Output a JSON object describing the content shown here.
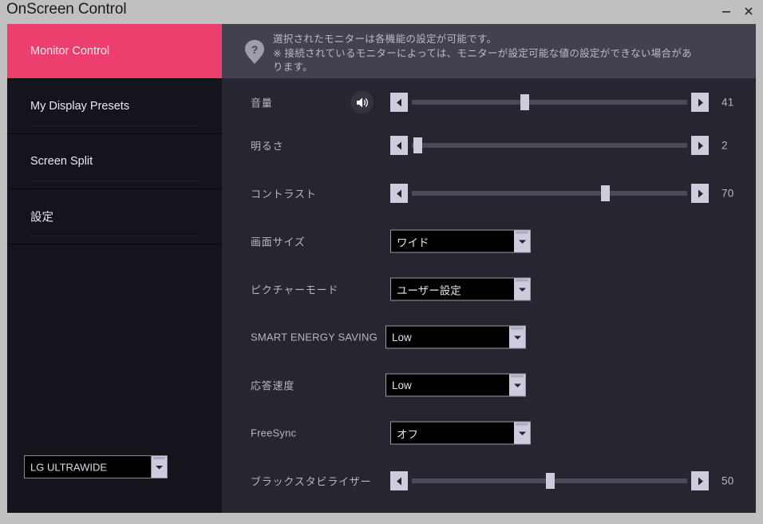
{
  "window": {
    "title": "OnScreen Control",
    "minimize_label": "minimize",
    "close_label": "close"
  },
  "sidebar": {
    "items": [
      {
        "label": "Monitor Control",
        "active": true
      },
      {
        "label": "My Display Presets",
        "active": false
      },
      {
        "label": "Screen Split",
        "active": false
      },
      {
        "label": "設定",
        "active": false
      }
    ],
    "monitor_select": {
      "value": "LG ULTRAWIDE",
      "icon": "chevron-down-icon"
    }
  },
  "help": {
    "icon": "question-mark-icon",
    "line1": "選択されたモニターは各機能の設定が可能です。",
    "line2": "※ 接続されているモニターによっては、モニターが設定可能な値の設定ができない場合があ",
    "line3": "ります。"
  },
  "controls": {
    "rows": [
      {
        "label": "音量",
        "type": "slider",
        "value": "41",
        "percent": 41,
        "has_speaker_icon": true,
        "speaker_icon": "speaker-volume-icon",
        "left_icon": "triangle-left-icon",
        "right_icon": "triangle-right-icon"
      },
      {
        "label": "明るさ",
        "type": "slider",
        "value": "2",
        "percent": 2,
        "has_speaker_icon": false,
        "left_icon": "triangle-left-icon",
        "right_icon": "triangle-right-icon"
      },
      {
        "label": "コントラスト",
        "type": "slider",
        "value": "70",
        "percent": 70,
        "has_speaker_icon": false,
        "left_icon": "triangle-left-icon",
        "right_icon": "triangle-right-icon"
      },
      {
        "label": "画面サイズ",
        "type": "dropdown",
        "value": "ワイド",
        "icon": "chevron-down-icon"
      },
      {
        "label": "ピクチャーモード",
        "type": "dropdown",
        "value": "ユーザー設定",
        "icon": "chevron-down-icon"
      },
      {
        "label": "SMART ENERGY SAVING",
        "type": "dropdown",
        "value": "Low",
        "latin": true,
        "icon": "chevron-down-icon"
      },
      {
        "label": "応答速度",
        "type": "dropdown",
        "value": "Low",
        "icon": "chevron-down-icon"
      },
      {
        "label": "FreeSync",
        "type": "dropdown",
        "value": "オフ",
        "latin": true,
        "icon": "chevron-down-icon"
      },
      {
        "label": "ブラックスタビライザー",
        "type": "slider",
        "value": "50",
        "percent": 50,
        "has_speaker_icon": false,
        "left_icon": "triangle-left-icon",
        "right_icon": "triangle-right-icon"
      }
    ]
  },
  "colors": {
    "accent_pink": "#ed3f6d",
    "sidebar_bg": "#14141c",
    "panel_bg": "#262630",
    "helpbar_bg": "#41414f",
    "titlebar_bg": "#c0c0c0",
    "control_light": "#ccccdd",
    "track": "#4a4a59"
  }
}
